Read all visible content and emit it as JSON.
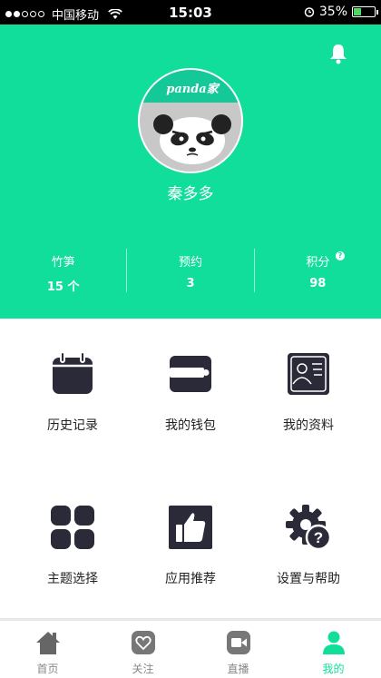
{
  "status_bar": {
    "carrier": "中国移动",
    "time": "15:03",
    "battery": "35%",
    "battery_level": 0.35
  },
  "profile": {
    "logo_text": "panda家",
    "username": "秦多多"
  },
  "stats": [
    {
      "label": "竹笋",
      "value": "15 个"
    },
    {
      "label": "预约",
      "value": "3"
    },
    {
      "label": "积分",
      "value": "98"
    }
  ],
  "grid": {
    "items": [
      {
        "label": "历史记录",
        "icon": "calendar-icon"
      },
      {
        "label": "我的钱包",
        "icon": "wallet-icon"
      },
      {
        "label": "我的资料",
        "icon": "profile-card-icon"
      },
      {
        "label": "主题选择",
        "icon": "grid-icon"
      },
      {
        "label": "应用推荐",
        "icon": "thumbs-up-icon"
      },
      {
        "label": "设置与帮助",
        "icon": "gear-help-icon"
      }
    ]
  },
  "tabs": [
    {
      "label": "首页",
      "icon": "home-icon"
    },
    {
      "label": "关注",
      "icon": "heart-icon"
    },
    {
      "label": "直播",
      "icon": "video-icon"
    },
    {
      "label": "我的",
      "icon": "person-icon",
      "active": true
    }
  ],
  "colors": {
    "accent": "#12de9b",
    "icon_dark": "#2a2a38",
    "tab_inactive": "#888888"
  }
}
